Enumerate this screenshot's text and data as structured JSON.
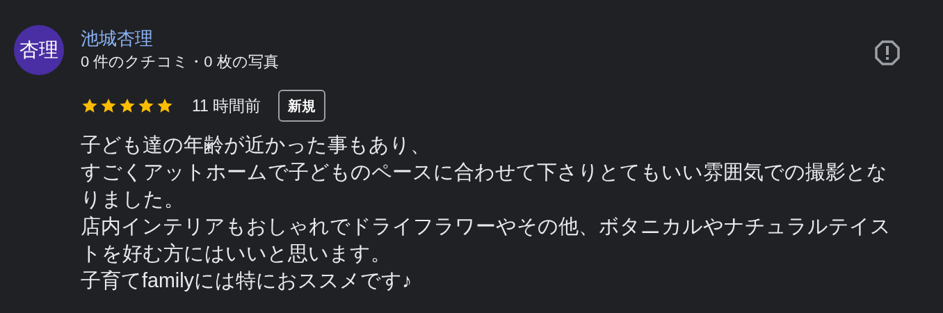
{
  "review": {
    "avatar": "杏理",
    "name": "池城杏理",
    "stats": "0 件のクチコミ・0 枚の写真",
    "stars": 5,
    "time": "11 時間前",
    "badge": "新規",
    "paragraphs": [
      "子ども達の年齢が近かった事もあり、",
      "すごくアットホームで子どものペースに合わせて下さりとてもいい雰囲気での撮影となりました。",
      "店内インテリアもおしゃれでドライフラワーやその他、ボタニカルやナチュラルテイストを好む方にはいいと思います。",
      "子育てfamilyには特におススメです♪"
    ]
  }
}
